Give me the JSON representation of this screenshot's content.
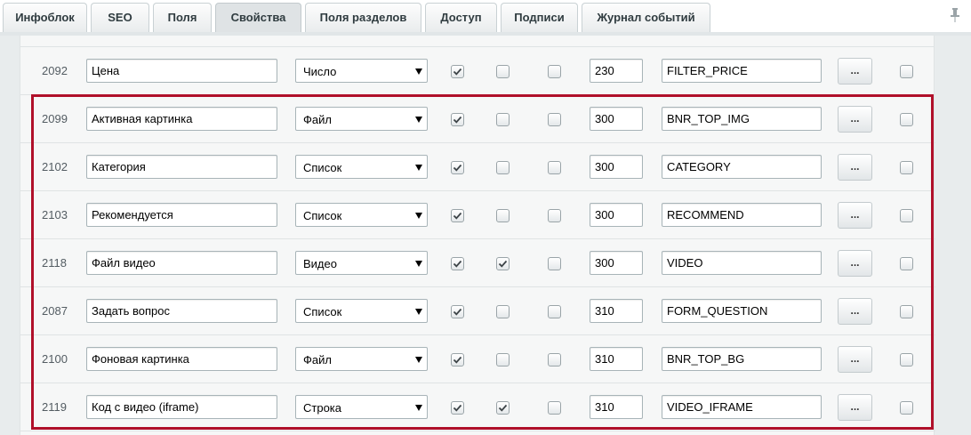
{
  "tabs": [
    {
      "label": "Инфоблок",
      "active": false
    },
    {
      "label": "SEO",
      "active": false
    },
    {
      "label": "Поля",
      "active": false
    },
    {
      "label": "Свойства",
      "active": true
    },
    {
      "label": "Поля разделов",
      "active": false
    },
    {
      "label": "Доступ",
      "active": false
    },
    {
      "label": "Подписи",
      "active": false
    },
    {
      "label": "Журнал событий",
      "active": false
    }
  ],
  "pin_icon": "pin-icon",
  "dots_label": "...",
  "colors": {
    "highlight": "#b0102a"
  },
  "rows": [
    {
      "id": "2092",
      "name": "Цена",
      "type": "Число",
      "c1": true,
      "c2": false,
      "c3": false,
      "sort": "230",
      "code": "FILTER_PRICE",
      "c4": false
    },
    {
      "id": "2099",
      "name": "Активная картинка",
      "type": "Файл",
      "c1": true,
      "c2": false,
      "c3": false,
      "sort": "300",
      "code": "BNR_TOP_IMG",
      "c4": false
    },
    {
      "id": "2102",
      "name": "Категория",
      "type": "Список",
      "c1": true,
      "c2": false,
      "c3": false,
      "sort": "300",
      "code": "CATEGORY",
      "c4": false
    },
    {
      "id": "2103",
      "name": "Рекомендуется",
      "type": "Список",
      "c1": true,
      "c2": false,
      "c3": false,
      "sort": "300",
      "code": "RECOMMEND",
      "c4": false
    },
    {
      "id": "2118",
      "name": "Файл видео",
      "type": "Видео",
      "c1": true,
      "c2": true,
      "c3": false,
      "sort": "300",
      "code": "VIDEO",
      "c4": false
    },
    {
      "id": "2087",
      "name": "Задать вопрос",
      "type": "Список",
      "c1": true,
      "c2": false,
      "c3": false,
      "sort": "310",
      "code": "FORM_QUESTION",
      "c4": false
    },
    {
      "id": "2100",
      "name": "Фоновая картинка",
      "type": "Файл",
      "c1": true,
      "c2": false,
      "c3": false,
      "sort": "310",
      "code": "BNR_TOP_BG",
      "c4": false
    },
    {
      "id": "2119",
      "name": "Код с видео (iframe)",
      "type": "Строка",
      "c1": true,
      "c2": true,
      "c3": false,
      "sort": "310",
      "code": "VIDEO_IFRAME",
      "c4": false
    }
  ]
}
